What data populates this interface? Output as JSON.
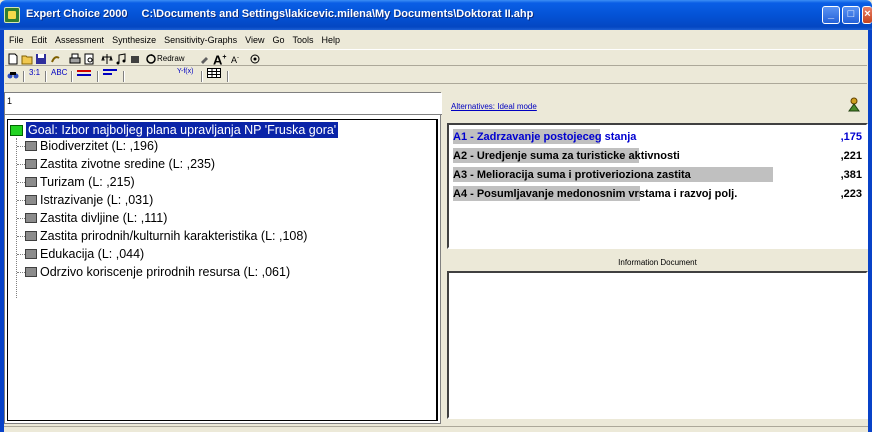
{
  "window": {
    "app_name": "Expert Choice 2000",
    "file_path": "C:\\Documents and Settings\\lakicevic.milena\\My Documents\\Doktorat II.ahp"
  },
  "menu": [
    "File",
    "Edit",
    "Assessment",
    "Synthesize",
    "Sensitivity-Graphs",
    "View",
    "Go",
    "Tools",
    "Help"
  ],
  "toolbar": {
    "redraw_label": "Redraw",
    "tabs": [
      "3:1",
      "ABC",
      "",
      "",
      "Y-f(x)",
      ""
    ]
  },
  "left_panel": {
    "header_value": "1",
    "goal": "Goal: Izbor najboljeg plana upravljanja NP 'Fruska gora'",
    "criteria": [
      "Biodiverzitet (L: ,196)",
      "Zastita zivotne sredine (L: ,235)",
      "Turizam (L: ,215)",
      "Istrazivanje (L: ,031)",
      "Zastita divljine (L: ,111)",
      "Zastita prirodnih/kulturnih karakteristika (L: ,108)",
      "Edukacija (L: ,044)",
      "Odrzivo koriscenje prirodnih resursa (L: ,061)"
    ]
  },
  "right_panel": {
    "mode_link": "Alternatives: Ideal mode",
    "alternatives": [
      {
        "label": "A1 - Zadrzavanje postojeceg stanja",
        "value": ",175",
        "bar_fraction": 0.175,
        "color": "#0000d0"
      },
      {
        "label": "A2 - Uredjenje suma za turisticke aktivnosti",
        "value": ",221",
        "bar_fraction": 0.221,
        "color": "#000000"
      },
      {
        "label": "A3 - Melioracija suma i protiverioziona zastita",
        "value": ",381",
        "bar_fraction": 0.381,
        "color": "#000000"
      },
      {
        "label": "A4 - Posumljavanje medonosnim vrstama i razvoj polj.",
        "value": ",223",
        "bar_fraction": 0.223,
        "color": "#000000"
      }
    ],
    "info_header": "Information Document"
  }
}
